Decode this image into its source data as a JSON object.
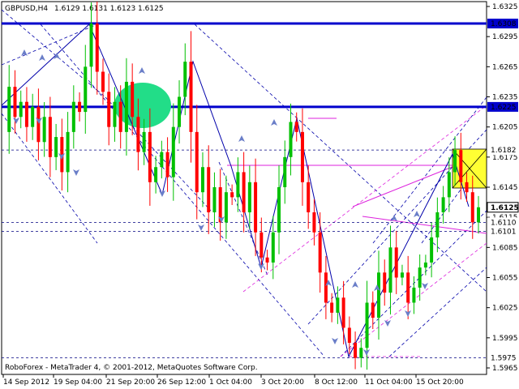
{
  "header": {
    "symbol_tf": "GBPUSD,H4",
    "ohlc": "1.6129 1.6131 1.6123 1.6125"
  },
  "footer": {
    "copyright": "RoboForex - MetaTrader 4, © 2001-2012, MetaQuotes Software Corp."
  },
  "colors": {
    "bull": "#00c000",
    "bear": "#ff0000",
    "level_line": "#0000cc",
    "trend": "#0000aa",
    "magenta": "#dd22dd",
    "ellipse": "#22dd88",
    "target_box": "#ffff33",
    "arrow": "#6a7ec8"
  },
  "chart_data": {
    "type": "candlestick",
    "symbol": "GBPUSD",
    "timeframe": "H4",
    "ylim": [
      1.5965,
      1.6325
    ],
    "y_ticks": [
      "1.6325",
      "1.6295",
      "1.6265",
      "1.6235",
      "1.6205",
      "1.6175",
      "1.6145",
      "1.6115",
      "1.6085",
      "1.6055",
      "1.6025",
      "1.5995",
      "1.5965"
    ],
    "x_ticks": [
      "14 Sep 2012",
      "19 Sep 04:00",
      "21 Sep 20:00",
      "26 Sep 12:00",
      "1 Oct 04:00",
      "3 Oct 20:00",
      "8 Oct 12:00",
      "11 Oct 04:00",
      "15 Oct 20:00"
    ],
    "price_labels": [
      {
        "label": "1.6308",
        "value": 1.6308,
        "kind": "level"
      },
      {
        "label": "1.6225",
        "value": 1.6225,
        "kind": "level"
      },
      {
        "label": "1.6182",
        "value": 1.6182,
        "kind": "dotted"
      },
      {
        "label": "1.6125",
        "value": 1.6125,
        "kind": "current"
      },
      {
        "label": "1.6110",
        "value": 1.611,
        "kind": "dotted"
      },
      {
        "label": "1.6101",
        "value": 1.6101,
        "kind": "dotted"
      },
      {
        "label": "1.5975",
        "value": 1.5975,
        "kind": "dotted"
      }
    ],
    "price_path": [
      1.62,
      1.6245,
      1.6215,
      1.623,
      1.6205,
      1.6225,
      1.619,
      1.6215,
      1.6175,
      1.6195,
      1.616,
      1.62,
      1.623,
      1.622,
      1.6265,
      1.6308,
      1.626,
      1.624,
      1.6205,
      1.623,
      1.62,
      1.625,
      1.6215,
      1.618,
      1.62,
      1.615,
      1.6165,
      1.618,
      1.6155,
      1.6205,
      1.6235,
      1.627,
      1.62,
      1.614,
      1.6165,
      1.612,
      1.6145,
      1.611,
      1.614,
      1.6135,
      1.616,
      1.612,
      1.615,
      1.61,
      1.6075,
      1.607,
      1.61,
      1.6145,
      1.6175,
      1.621,
      1.62,
      1.615,
      1.612,
      1.61,
      1.606,
      1.603,
      1.602,
      1.6035,
      1.6005,
      1.599,
      1.5975,
      1.5985,
      1.603,
      1.6015,
      1.606,
      1.604,
      1.6085,
      1.6055,
      1.606,
      1.603,
      1.6045,
      1.6065,
      1.607,
      1.6095,
      1.612,
      1.6135,
      1.616,
      1.6182,
      1.615,
      1.614,
      1.611,
      1.6125
    ]
  }
}
